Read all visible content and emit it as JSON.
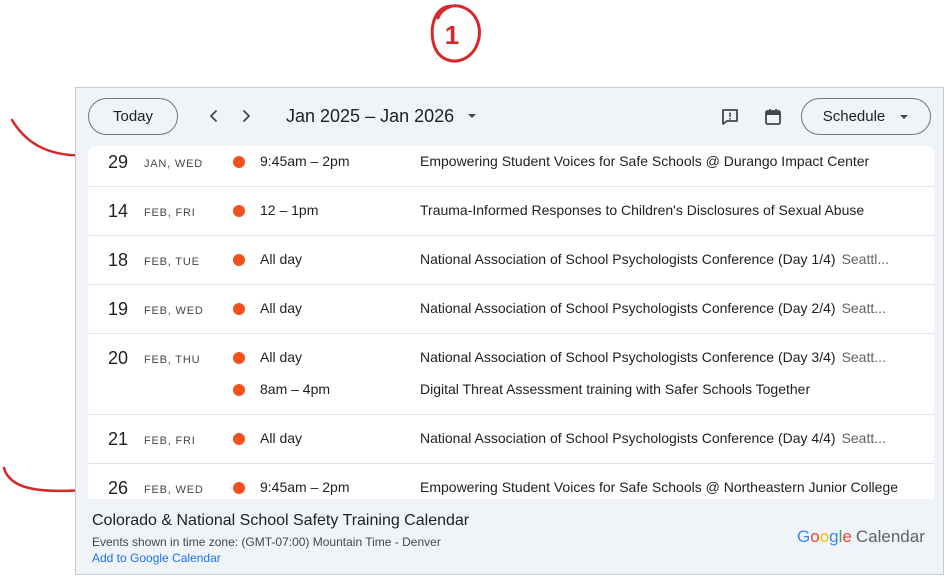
{
  "annotation": {
    "circled_label": "1"
  },
  "toolbar": {
    "today_label": "Today",
    "prev_icon": "chevron-left-icon",
    "next_icon": "chevron-right-icon",
    "date_range": "Jan 2025 – Jan 2026",
    "feedback_icon": "feedback-icon",
    "calendar_icon": "calendar-icon",
    "view_label": "Schedule"
  },
  "colors": {
    "event_dot": "#f4511e",
    "link": "#1a73e8",
    "annotation": "#d62828"
  },
  "days": [
    {
      "num": "29",
      "sub": "JAN, WED",
      "events": [
        {
          "time": "9:45am – 2pm",
          "title": "Empowering Student Voices for Safe Schools @ Durango Impact Center",
          "location": ""
        }
      ]
    },
    {
      "num": "14",
      "sub": "FEB, FRI",
      "events": [
        {
          "time": "12 – 1pm",
          "title": "Trauma-Informed Responses to Children's Disclosures of Sexual Abuse",
          "location": ""
        }
      ]
    },
    {
      "num": "18",
      "sub": "FEB, TUE",
      "events": [
        {
          "time": "All day",
          "title": "National Association of School Psychologists Conference (Day 1/4)",
          "location": "Seattl..."
        }
      ]
    },
    {
      "num": "19",
      "sub": "FEB, WED",
      "events": [
        {
          "time": "All day",
          "title": "National Association of School Psychologists Conference (Day 2/4)",
          "location": "Seatt..."
        }
      ]
    },
    {
      "num": "20",
      "sub": "FEB, THU",
      "events": [
        {
          "time": "All day",
          "title": "National Association of School Psychologists Conference (Day 3/4)",
          "location": "Seatt..."
        },
        {
          "time": "8am – 4pm",
          "title": "Digital Threat Assessment training with Safer Schools Together",
          "location": ""
        }
      ]
    },
    {
      "num": "21",
      "sub": "FEB, FRI",
      "events": [
        {
          "time": "All day",
          "title": "National Association of School Psychologists Conference (Day 4/4)",
          "location": "Seatt..."
        }
      ]
    },
    {
      "num": "26",
      "sub": "FEB, WED",
      "events": [
        {
          "time": "9:45am – 2pm",
          "title": "Empowering Student Voices for Safe Schools @ Northeastern Junior College",
          "location": ""
        }
      ]
    }
  ],
  "footer": {
    "calendar_name": "Colorado & National School Safety Training Calendar",
    "timezone_note": "Events shown in time zone: (GMT-07:00) Mountain Time - Denver",
    "add_link": "Add to Google Calendar",
    "brand_google": "Google",
    "brand_calendar": "Calendar"
  }
}
